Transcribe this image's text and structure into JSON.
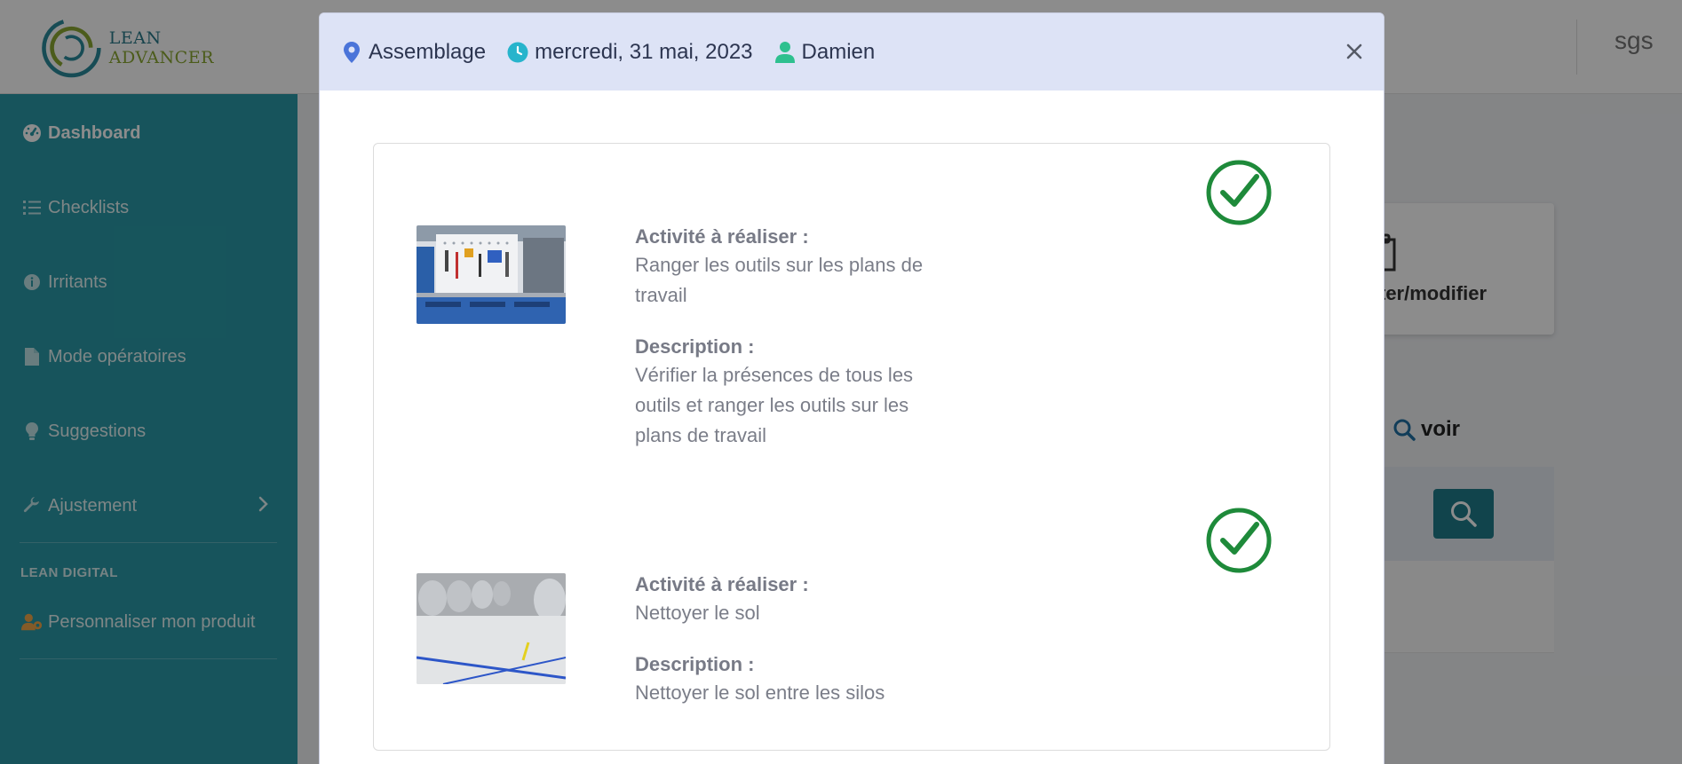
{
  "topbar": {
    "logo_text_lean": "LEAN",
    "logo_text_advancer": "ADVANCER",
    "user": "sgs"
  },
  "sidebar": {
    "items": [
      {
        "label": "Dashboard",
        "icon": "dashboard-gauge-icon",
        "active": true
      },
      {
        "label": "Checklists",
        "icon": "list-icon"
      },
      {
        "label": "Irritants",
        "icon": "info-circle-icon"
      },
      {
        "label": "Mode opératoires",
        "icon": "document-icon"
      },
      {
        "label": "Suggestions",
        "icon": "lightbulb-icon"
      },
      {
        "label": "Ajustement",
        "icon": "wrench-icon",
        "has_submenu": true
      }
    ],
    "section_heading": "LEAN DIGITAL",
    "section_items": [
      {
        "label": "Personnaliser mon produit",
        "icon": "user-gear-icon"
      }
    ]
  },
  "background": {
    "card_label": "ter/modifier",
    "voir_label": "voir"
  },
  "modal": {
    "location": "Assemblage",
    "date": "mercredi, 31 mai, 2023",
    "person": "Damien",
    "activities": [
      {
        "activity_label": "Activité à réaliser :",
        "activity_lines": [
          "Ranger les outils sur les plans de",
          "travail"
        ],
        "description_label": "Description :",
        "description_lines": [
          "Vérifier la présences de tous les",
          "outils et ranger les outils sur les",
          "plans de travail"
        ],
        "image": "tool-pegboard-photo",
        "status": "done"
      },
      {
        "activity_label": "Activité à réaliser :",
        "activity_lines": [
          "Nettoyer le sol"
        ],
        "description_label": "Description :",
        "description_lines": [
          "Nettoyer le sol entre les silos"
        ],
        "image": "factory-floor-silos-photo",
        "status": "done"
      }
    ]
  },
  "colors": {
    "sidebar": "#2a9aa8",
    "modal_header": "#dde3f6",
    "check_green": "#1e8a3a",
    "accent_teal": "#1f7d8a"
  }
}
